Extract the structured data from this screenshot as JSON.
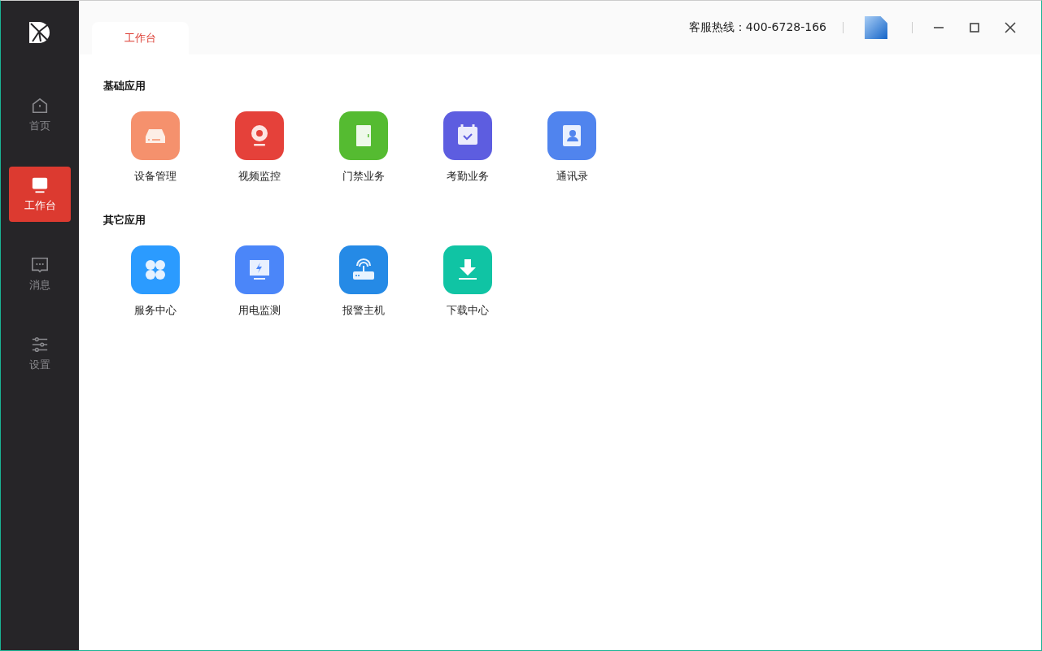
{
  "sidebar": {
    "items": [
      {
        "kind": "home",
        "label": "首页",
        "selected": false
      },
      {
        "kind": "desk",
        "label": "工作台",
        "selected": true
      },
      {
        "kind": "message",
        "label": "消息",
        "selected": false
      },
      {
        "kind": "settings",
        "label": "设置",
        "selected": false
      }
    ]
  },
  "tabs": [
    {
      "label": "工作台",
      "selected": true
    }
  ],
  "header": {
    "hotline": "客服热线：400-6728-166"
  },
  "sections": [
    {
      "title": "基础应用",
      "apps": [
        {
          "kind": "drive",
          "label": "设备管理",
          "color": "#f5916d"
        },
        {
          "kind": "camera",
          "label": "视频监控",
          "color": "#e5413a"
        },
        {
          "kind": "door",
          "label": "门禁业务",
          "color": "#55bb31"
        },
        {
          "kind": "calendar",
          "label": "考勤业务",
          "color": "#5d5de0"
        },
        {
          "kind": "contacts",
          "label": "通讯录",
          "color": "#5084ee"
        }
      ]
    },
    {
      "title": "其它应用",
      "apps": [
        {
          "kind": "clover",
          "label": "服务中心",
          "color": "#2b9bff"
        },
        {
          "kind": "monitor",
          "label": "用电监测",
          "color": "#4b86f9"
        },
        {
          "kind": "router",
          "label": "报警主机",
          "color": "#258ae6"
        },
        {
          "kind": "download",
          "label": "下载中心",
          "color": "#10c4a4"
        }
      ]
    }
  ]
}
